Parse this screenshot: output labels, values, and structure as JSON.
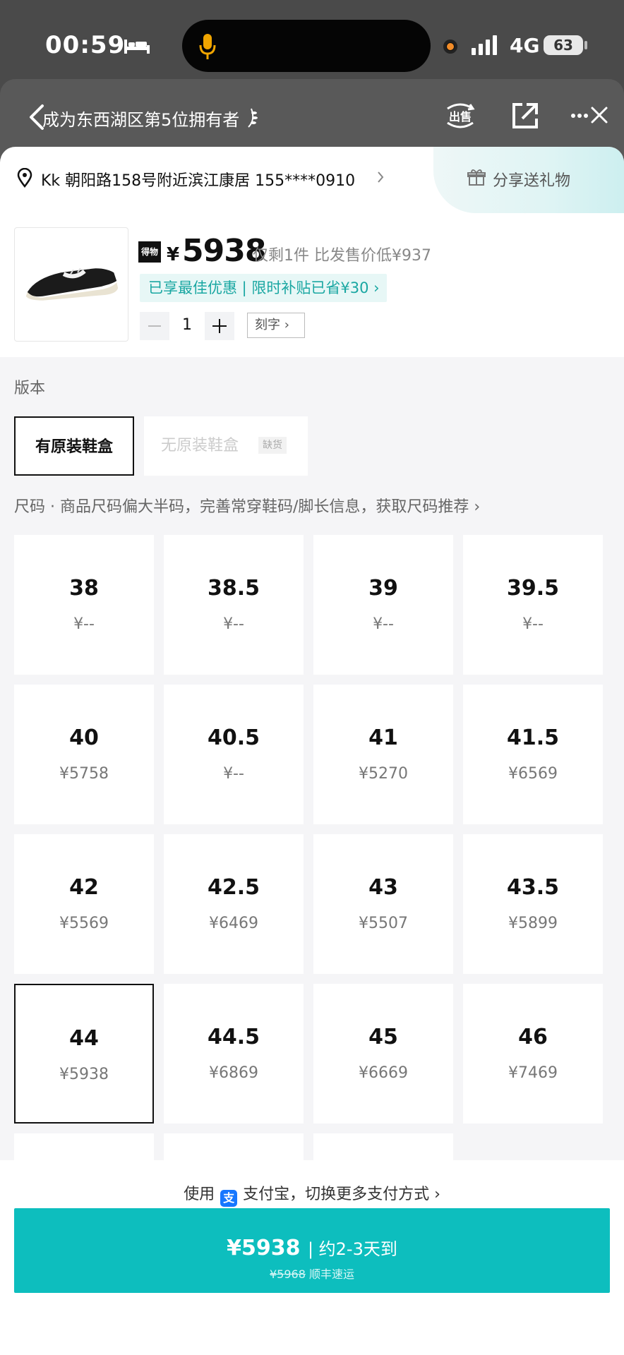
{
  "status_bar": {
    "time": "00:59",
    "network": "4G",
    "battery": "63"
  },
  "header": {
    "title": "成为东西湖区第5位拥有者",
    "sell_label": "出售"
  },
  "address": {
    "text": "Kk  朝阳路158号附近滨江康居  155****0910",
    "gift_label": "分享送礼物"
  },
  "product": {
    "badge": "得物",
    "currency": "¥",
    "price": "5938",
    "stock_note": "仅剩1件  比发售价低¥937",
    "promo": "已享最佳优惠 | 限时补贴已省¥30 ›",
    "quantity": "1",
    "engrave_label": "刻字 ›"
  },
  "version": {
    "label": "版本",
    "options": [
      {
        "label": "有原装鞋盒",
        "selected": true
      },
      {
        "label": "无原装鞋盒",
        "tag": "缺货",
        "selected": false
      }
    ]
  },
  "size_info": "尺码  ·  商品尺码偏大半码，完善常穿鞋码/脚长信息，获取尺码推荐 ›",
  "sizes": [
    {
      "size": "38",
      "price": "¥--"
    },
    {
      "size": "38.5",
      "price": "¥--"
    },
    {
      "size": "39",
      "price": "¥--"
    },
    {
      "size": "39.5",
      "price": "¥--"
    },
    {
      "size": "40",
      "price": "¥5758"
    },
    {
      "size": "40.5",
      "price": "¥--"
    },
    {
      "size": "41",
      "price": "¥5270"
    },
    {
      "size": "41.5",
      "price": "¥6569"
    },
    {
      "size": "42",
      "price": "¥5569"
    },
    {
      "size": "42.5",
      "price": "¥6469"
    },
    {
      "size": "43",
      "price": "¥5507"
    },
    {
      "size": "43.5",
      "price": "¥5899"
    },
    {
      "size": "44",
      "price": "¥5938",
      "selected": true
    },
    {
      "size": "44.5",
      "price": "¥6869"
    },
    {
      "size": "45",
      "price": "¥6669"
    },
    {
      "size": "46",
      "price": "¥7469"
    }
  ],
  "footer": {
    "pay_prefix": "使用",
    "pay_suffix": "支付宝，切换更多支付方式 ›",
    "buy_price": "¥5938",
    "buy_eta": "| 约2-3天到",
    "buy_old_price": "¥5968",
    "buy_shipping": "顺丰速运"
  },
  "colors": {
    "accent": "#0dbebe",
    "promo_text": "#1aa7a2",
    "promo_bg": "#e7f7f6"
  }
}
